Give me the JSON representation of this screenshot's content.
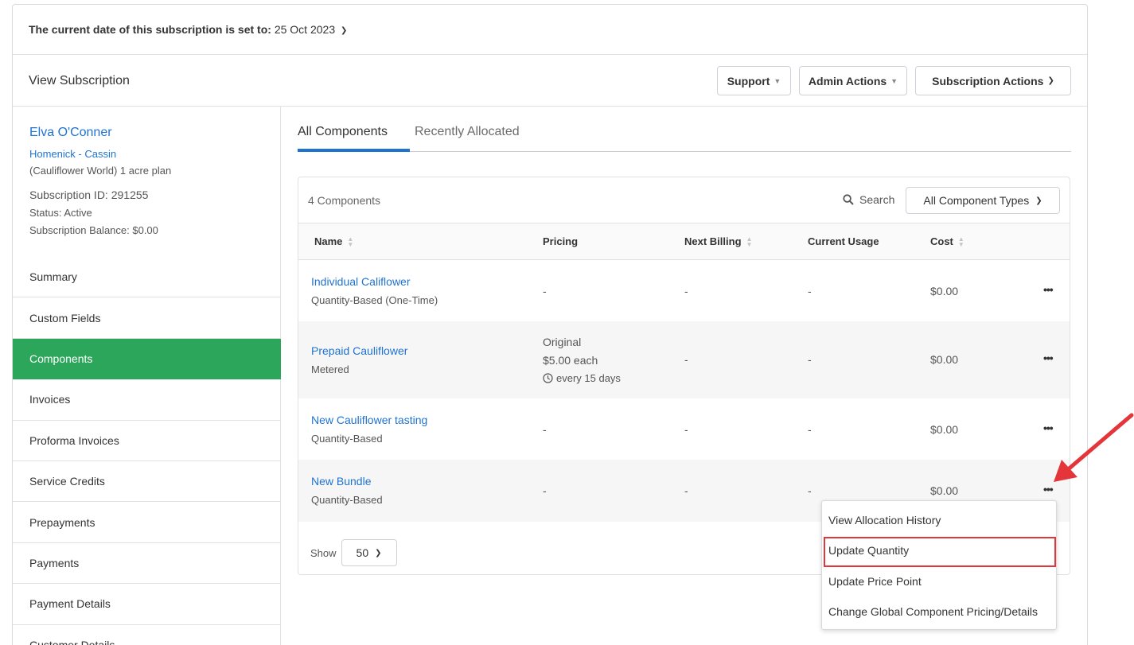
{
  "date_bar": {
    "label": "The current date of this subscription is set to:",
    "value": "25 Oct 2023",
    "chevron_icon": "chevron-down-icon"
  },
  "header": {
    "title": "View Subscription",
    "support_label": "Support",
    "admin_actions_label": "Admin Actions",
    "subscription_actions_label": "Subscription Actions"
  },
  "customer": {
    "name": "Elva O'Conner",
    "organization": "Homenick - Cassin",
    "plan": "(Cauliflower World) 1 acre plan",
    "subscription_id": "Subscription ID: 291255",
    "status": "Status: Active",
    "balance": "Subscription Balance: $0.00"
  },
  "sidebar": {
    "items": [
      {
        "label": "Summary"
      },
      {
        "label": "Custom Fields"
      },
      {
        "label": "Components",
        "active": true
      },
      {
        "label": "Invoices"
      },
      {
        "label": "Proforma Invoices"
      },
      {
        "label": "Service Credits"
      },
      {
        "label": "Prepayments"
      },
      {
        "label": "Payments"
      },
      {
        "label": "Payment Details"
      },
      {
        "label": "Customer Details"
      }
    ]
  },
  "tabs": [
    {
      "label": "All Components",
      "active": true
    },
    {
      "label": "Recently Allocated"
    }
  ],
  "components": {
    "count": "4 Components",
    "search_label": "Search",
    "type_filter": "All Component Types",
    "columns": [
      "Name",
      "Pricing",
      "Next Billing",
      "Current Usage",
      "Cost"
    ],
    "rows": [
      {
        "name": "Individual Califlower",
        "type": "Quantity-Based (One-Time)",
        "pricing": "-",
        "next_billing": "-",
        "usage": "-",
        "cost": "$0.00"
      },
      {
        "name": "Prepaid Cauliflower",
        "type": "Metered",
        "pricing_line1": "Original",
        "pricing_line2": "$5.00 each",
        "pricing_line3": "every 15 days",
        "next_billing": "-",
        "usage": "-",
        "cost": "$0.00"
      },
      {
        "name": "New Cauliflower tasting",
        "type": "Quantity-Based",
        "pricing": "-",
        "next_billing": "-",
        "usage": "-",
        "cost": "$0.00"
      },
      {
        "name": "New Bundle",
        "type": "Quantity-Based",
        "pricing": "-",
        "next_billing": "-",
        "usage": "-",
        "cost": "$0.00"
      }
    ],
    "show_label": "Show",
    "page_size": "50"
  },
  "row_menu": {
    "items": [
      {
        "label": "View Allocation History"
      },
      {
        "label": "Update Quantity",
        "highlighted": true
      },
      {
        "label": "Update Price Point"
      },
      {
        "label": "Change Global Component Pricing/Details"
      }
    ]
  },
  "colors": {
    "accent_blue": "#1f73d1",
    "active_green": "#2ca65a",
    "highlight_red": "#e4363a"
  }
}
